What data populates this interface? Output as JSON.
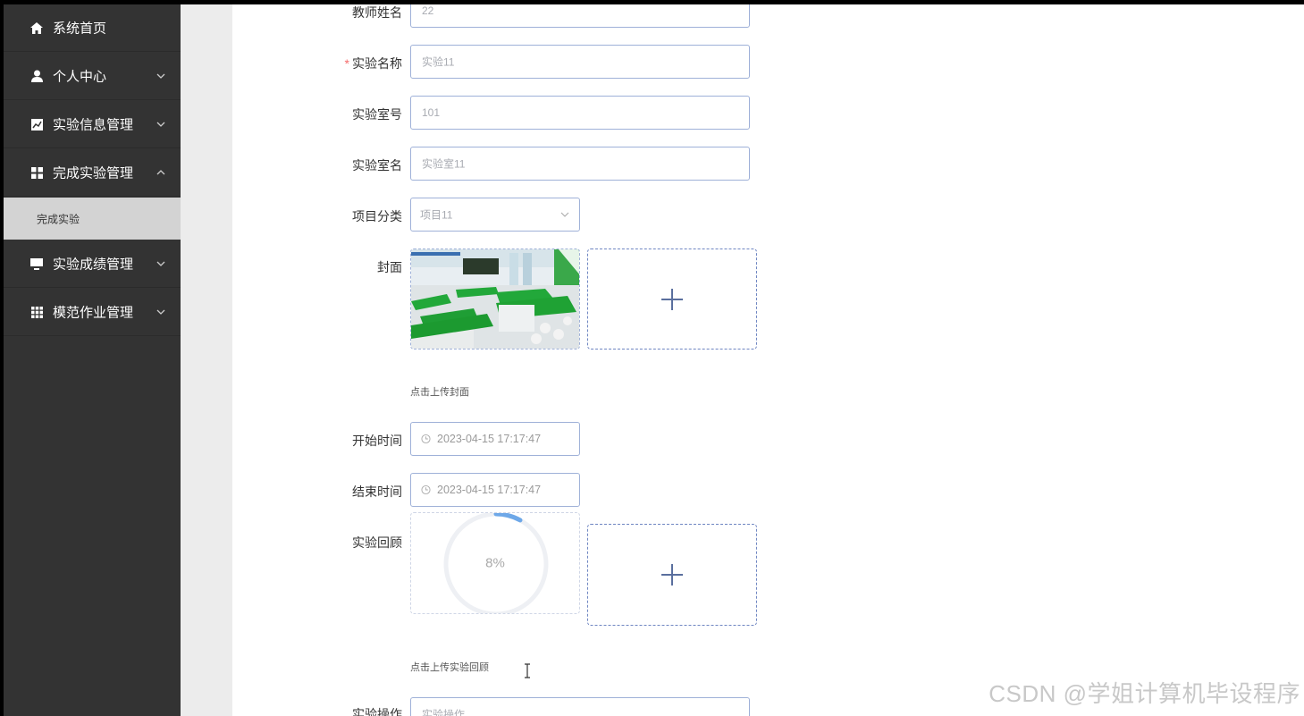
{
  "sidebar": {
    "items": [
      {
        "label": "系统首页",
        "icon": "home-icon",
        "expanded": null
      },
      {
        "label": "个人中心",
        "icon": "user-icon",
        "expanded": false
      },
      {
        "label": "实验信息管理",
        "icon": "chart-icon",
        "expanded": false
      },
      {
        "label": "完成实验管理",
        "icon": "grid-icon",
        "expanded": true
      },
      {
        "label": "实验成绩管理",
        "icon": "monitor-icon",
        "expanded": false
      },
      {
        "label": "模范作业管理",
        "icon": "table-icon",
        "expanded": false
      }
    ],
    "submenu": {
      "label": "完成实验",
      "selected": true
    }
  },
  "form": {
    "teacher_name": {
      "label": "教师姓名",
      "value": "22"
    },
    "experiment_name": {
      "label": "实验名称",
      "required_mark": "*",
      "placeholder": "实验11"
    },
    "lab_number": {
      "label": "实验室号",
      "value": "101"
    },
    "lab_name": {
      "label": "实验室名",
      "placeholder": "实验室11"
    },
    "project_category": {
      "label": "项目分类",
      "value": "项目11"
    },
    "cover": {
      "label": "封面",
      "hint": "点击上传封面"
    },
    "start_time": {
      "label": "开始时间",
      "value": "2023-04-15 17:17:47"
    },
    "end_time": {
      "label": "结束时间",
      "value": "2023-04-15 17:17:47"
    },
    "review": {
      "label": "实验回顾",
      "progress_text": "8%",
      "progress": 0.08,
      "hint": "点击上传实验回顾"
    },
    "operation": {
      "label": "实验操作",
      "placeholder": "实验操作"
    }
  },
  "watermark": "CSDN @学姐计算机毕设程序",
  "colors": {
    "sidebar_bg": "#333333",
    "submenu_bg": "#d3d3d3",
    "border": "#9fb1d8",
    "required": "#f56c6c"
  }
}
